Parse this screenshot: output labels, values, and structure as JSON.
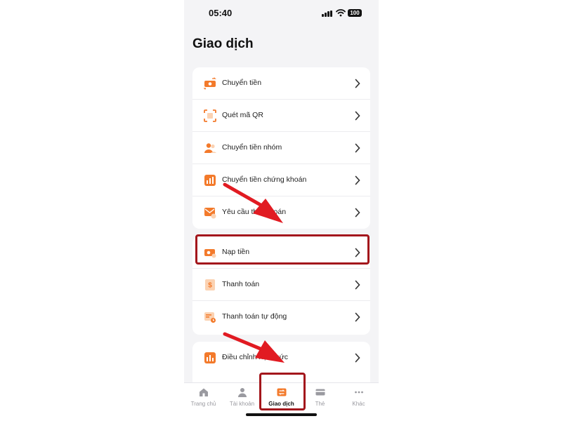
{
  "status_bar": {
    "time": "05:40",
    "battery": "100"
  },
  "page": {
    "title": "Giao dịch"
  },
  "colors": {
    "accent": "#f37a2b",
    "accent_light": "#fbd2b2",
    "highlight": "#a3161c",
    "arrow": "#e11b22"
  },
  "groups": [
    {
      "items": [
        {
          "label": "Chuyển tiền",
          "icon": "transfer-icon"
        },
        {
          "label": "Quét mã QR",
          "icon": "qr-scan-icon"
        },
        {
          "label": "Chuyển tiền nhóm",
          "icon": "group-icon"
        },
        {
          "label": "Chuyển tiền chứng khoán",
          "icon": "stock-icon"
        },
        {
          "label": "Yêu cầu thanh toán",
          "icon": "request-icon"
        }
      ]
    },
    {
      "items": [
        {
          "label": "Nạp tiền",
          "icon": "topup-icon"
        },
        {
          "label": "Thanh toán",
          "icon": "bill-icon"
        },
        {
          "label": "Thanh toán tự động",
          "icon": "auto-pay-icon"
        }
      ]
    },
    {
      "items": [
        {
          "label": "Điều chỉnh hạn mức",
          "icon": "limit-icon"
        }
      ]
    }
  ],
  "tabbar": {
    "tabs": [
      {
        "label": "Trang chủ",
        "icon": "home-icon",
        "active": false
      },
      {
        "label": "Tài khoản",
        "icon": "account-icon",
        "active": false
      },
      {
        "label": "Giao dịch",
        "icon": "transaction-icon",
        "active": true
      },
      {
        "label": "Thẻ",
        "icon": "card-icon",
        "active": false
      },
      {
        "label": "Khác",
        "icon": "more-icon",
        "active": false
      }
    ]
  }
}
